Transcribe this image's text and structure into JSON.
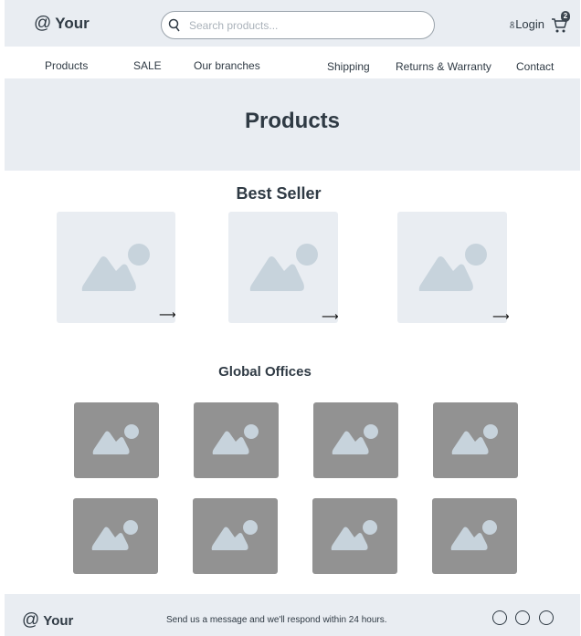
{
  "header": {
    "logo_symbol": "@",
    "logo_text": "Your",
    "search_placeholder": "Search products...",
    "login_label": "Login",
    "cart_count": "2"
  },
  "nav": {
    "items": [
      "Products",
      "SALE",
      "Our branches",
      "Shipping",
      "Returns & Warranty",
      "Contact"
    ]
  },
  "banner": {
    "title": "Products"
  },
  "best_seller": {
    "title": "Best Seller",
    "arrow": "⟶"
  },
  "offices": {
    "title": "Global Offices"
  },
  "footer": {
    "logo_symbol": "@",
    "logo_text": "Your",
    "message": "Send us a message and we'll respond within 24 hours."
  },
  "colors": {
    "header_bg": "#e9edf2",
    "text": "#2f3a44",
    "placeholder_art": "#c7d3dc",
    "office_tile": "#929292"
  }
}
